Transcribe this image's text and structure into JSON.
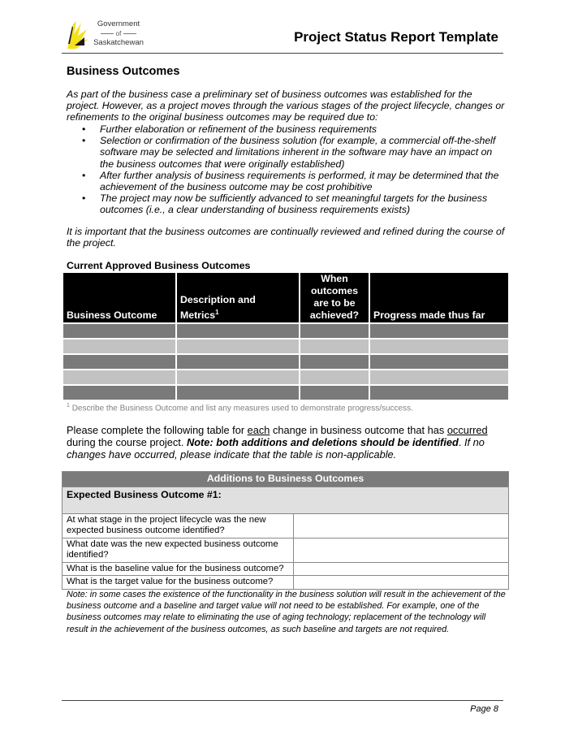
{
  "header": {
    "logo": {
      "icon": "saskatchewan-wheat-logo-icon",
      "line1": "Government",
      "line2": "of",
      "line3": "Saskatchewan",
      "colors": {
        "yellow": "#f5e11a",
        "dark": "#1a1a1a"
      }
    },
    "title": "Project Status Report Template"
  },
  "section": {
    "heading": "Business Outcomes",
    "intro": "As part of the business case a preliminary set of business outcomes was established for the project. However, as a project moves through the various stages of the project lifecycle, changes or refinements to the original business outcomes may be required due to:",
    "bullets": [
      "Further elaboration or refinement of the business requirements",
      "Selection or confirmation of the business solution (for example, a commercial off-the-shelf software may be selected and limitations inherent in the software may have an impact on the business outcomes that were originally established)",
      "After further analysis of business requirements is performed, it may be determined that the achievement of the business outcome may be cost prohibitive",
      "The project may now be sufficiently advanced to set meaningful targets for the business outcomes (i.e., a clear understanding of business requirements exists)"
    ],
    "important": "It is important that the business outcomes are continually reviewed and refined during the course of the project."
  },
  "approved_table": {
    "heading": "Current Approved Business Outcomes",
    "columns": [
      {
        "label": "Business Outcome",
        "sup": ""
      },
      {
        "label": "Description and Metrics",
        "sup": "1"
      },
      {
        "label": "When outcomes are to be achieved?",
        "sup": ""
      },
      {
        "label": "Progress made thus far",
        "sup": ""
      }
    ],
    "rows": [
      [
        "",
        "",
        "",
        ""
      ],
      [
        "",
        "",
        "",
        ""
      ],
      [
        "",
        "",
        "",
        ""
      ],
      [
        "",
        "",
        "",
        ""
      ],
      [
        "",
        "",
        "",
        ""
      ]
    ],
    "colors": {
      "header": "#000000",
      "row_dark": "#7a7a7a",
      "row_light": "#c2c2c2"
    },
    "footnote_mark": "1",
    "footnote": "Describe the Business Outcome and list any measures used to demonstrate progress/success."
  },
  "instructions": {
    "part1": "Please complete the following table for ",
    "each": "each",
    "part2": " change in business outcome that has ",
    "occurred": "occurred",
    "part3": " during the course project.  ",
    "note": "Note: both additions and deletions should be identified",
    "part4": ".  ",
    "italic": "If no changes have occurred, please indicate that the table is non-applicable."
  },
  "additions_table": {
    "banner": "Additions to Business Outcomes",
    "subheading": "Expected Business Outcome #1:",
    "rows": [
      {
        "question": "At what stage in the project lifecycle was the new expected business outcome identified?",
        "answer": ""
      },
      {
        "question": "What date was the new expected business outcome identified?",
        "answer": ""
      },
      {
        "question": "What is the baseline value for the business outcome?",
        "answer": ""
      },
      {
        "question": "What is the target value for the business outcome?",
        "answer": ""
      }
    ],
    "colors": {
      "banner": "#7b7b7b",
      "subheading": "#e0e0e0"
    },
    "note": "Note: in some cases the existence of the functionality in the business solution will result in the achievement of the business outcome and a baseline and target value will not need to be established.  For example, one of the business outcomes may relate to eliminating the use of aging technology; replacement of the technology will result in the achievement of the business outcomes, as such baseline and targets are not required."
  },
  "footer": {
    "page": "Page 8"
  }
}
